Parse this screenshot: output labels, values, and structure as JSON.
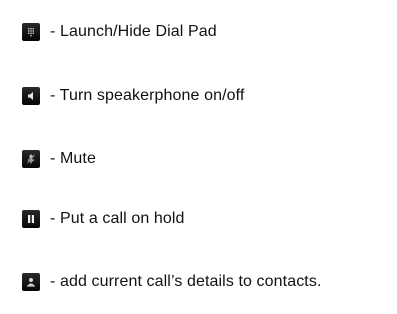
{
  "legend": {
    "items": [
      {
        "icon": "dialpad-icon",
        "text": " - Launch/Hide Dial Pad"
      },
      {
        "icon": "speaker-icon",
        "text": " - Turn speakerphone on/off"
      },
      {
        "icon": "mute-icon",
        "text": "- Mute"
      },
      {
        "icon": "hold-icon",
        "text": " - Put a call on hold"
      },
      {
        "icon": "add-contact-icon",
        "text": " - add current call’s details to contacts."
      }
    ]
  }
}
